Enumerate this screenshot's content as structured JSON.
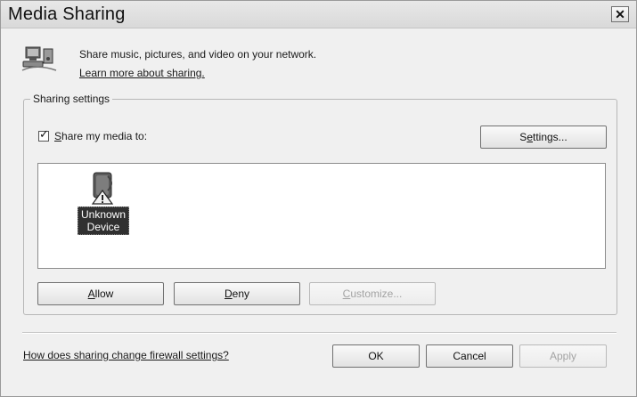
{
  "window": {
    "title": "Media Sharing",
    "close_label": "✕"
  },
  "header": {
    "description": "Share music, pictures, and video on your network.",
    "learn_more_link": "Learn more about sharing."
  },
  "sharing_settings": {
    "group_label": "Sharing settings",
    "share_checkbox": {
      "checked": true,
      "accel": "S",
      "label_rest": "hare my media to:"
    },
    "settings_button": {
      "pre": "S",
      "accel": "e",
      "post": "ttings..."
    },
    "devices": [
      {
        "name_line1": "Unknown",
        "name_line2": "Device",
        "icon": "unknown-device-warning-icon"
      }
    ],
    "allow_button": {
      "accel": "A",
      "rest": "llow"
    },
    "deny_button": {
      "accel": "D",
      "rest": "eny"
    },
    "customize_button": {
      "accel": "C",
      "rest": "ustomize...",
      "enabled": false
    }
  },
  "footer": {
    "firewall_link": "How does sharing change firewall settings?",
    "ok_label": "OK",
    "cancel_label": "Cancel",
    "apply_label": "Apply",
    "apply_enabled": false
  }
}
